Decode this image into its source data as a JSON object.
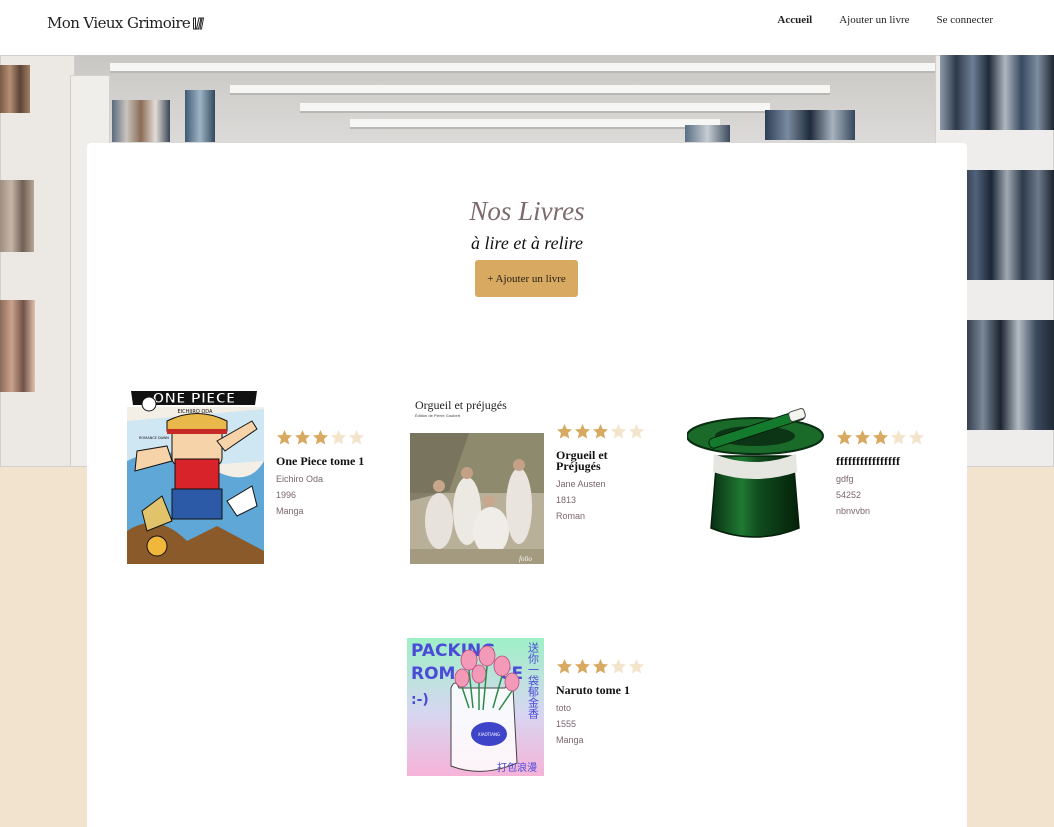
{
  "header": {
    "logo_text": "Mon Vieux Grimoire",
    "nav": [
      {
        "label": "Accueil",
        "active": true
      },
      {
        "label": "Ajouter un livre",
        "active": false
      },
      {
        "label": "Se connecter",
        "active": false
      }
    ]
  },
  "main": {
    "title": "Nos Livres",
    "subtitle": "à lire et à relire",
    "add_button_label": "+ Ajouter un livre"
  },
  "books": [
    {
      "title": "One Piece tome 1",
      "author": "Eichiro Oda",
      "year": "1996",
      "genre": "Manga",
      "rating": 3,
      "cover": "one-piece-cover"
    },
    {
      "title": "Orgueil et Préjugés",
      "author": "Jane Austen",
      "year": "1813",
      "genre": "Roman",
      "rating": 3,
      "cover": "orgueil-cover",
      "cover_caption": "Orgueil et préjugés",
      "cover_subcaption": "Édition de Pierre Goubert"
    },
    {
      "title": "ffffffffffffffff",
      "author": "gdfg",
      "year": "54252",
      "genre": "nbnvvbn",
      "rating": 3,
      "cover": "magic-hat-cover"
    },
    {
      "title": "Naruto tome 1",
      "author": "toto",
      "year": "1555",
      "genre": "Manga",
      "rating": 3,
      "cover": "packing-romance-cover",
      "cover_text_1": "PACKING",
      "cover_text_2": "ROM",
      "cover_text_3": "CE",
      "cover_side_text": "送你一袋郁金香",
      "cover_bottom_text": "打包浪漫"
    }
  ],
  "colors": {
    "accent": "#d8a960",
    "star_filled": "#d8a960",
    "star_empty": "#f3e4cc",
    "title": "#7c6a6d",
    "background": "#f2e3cf"
  },
  "max_rating": 5
}
